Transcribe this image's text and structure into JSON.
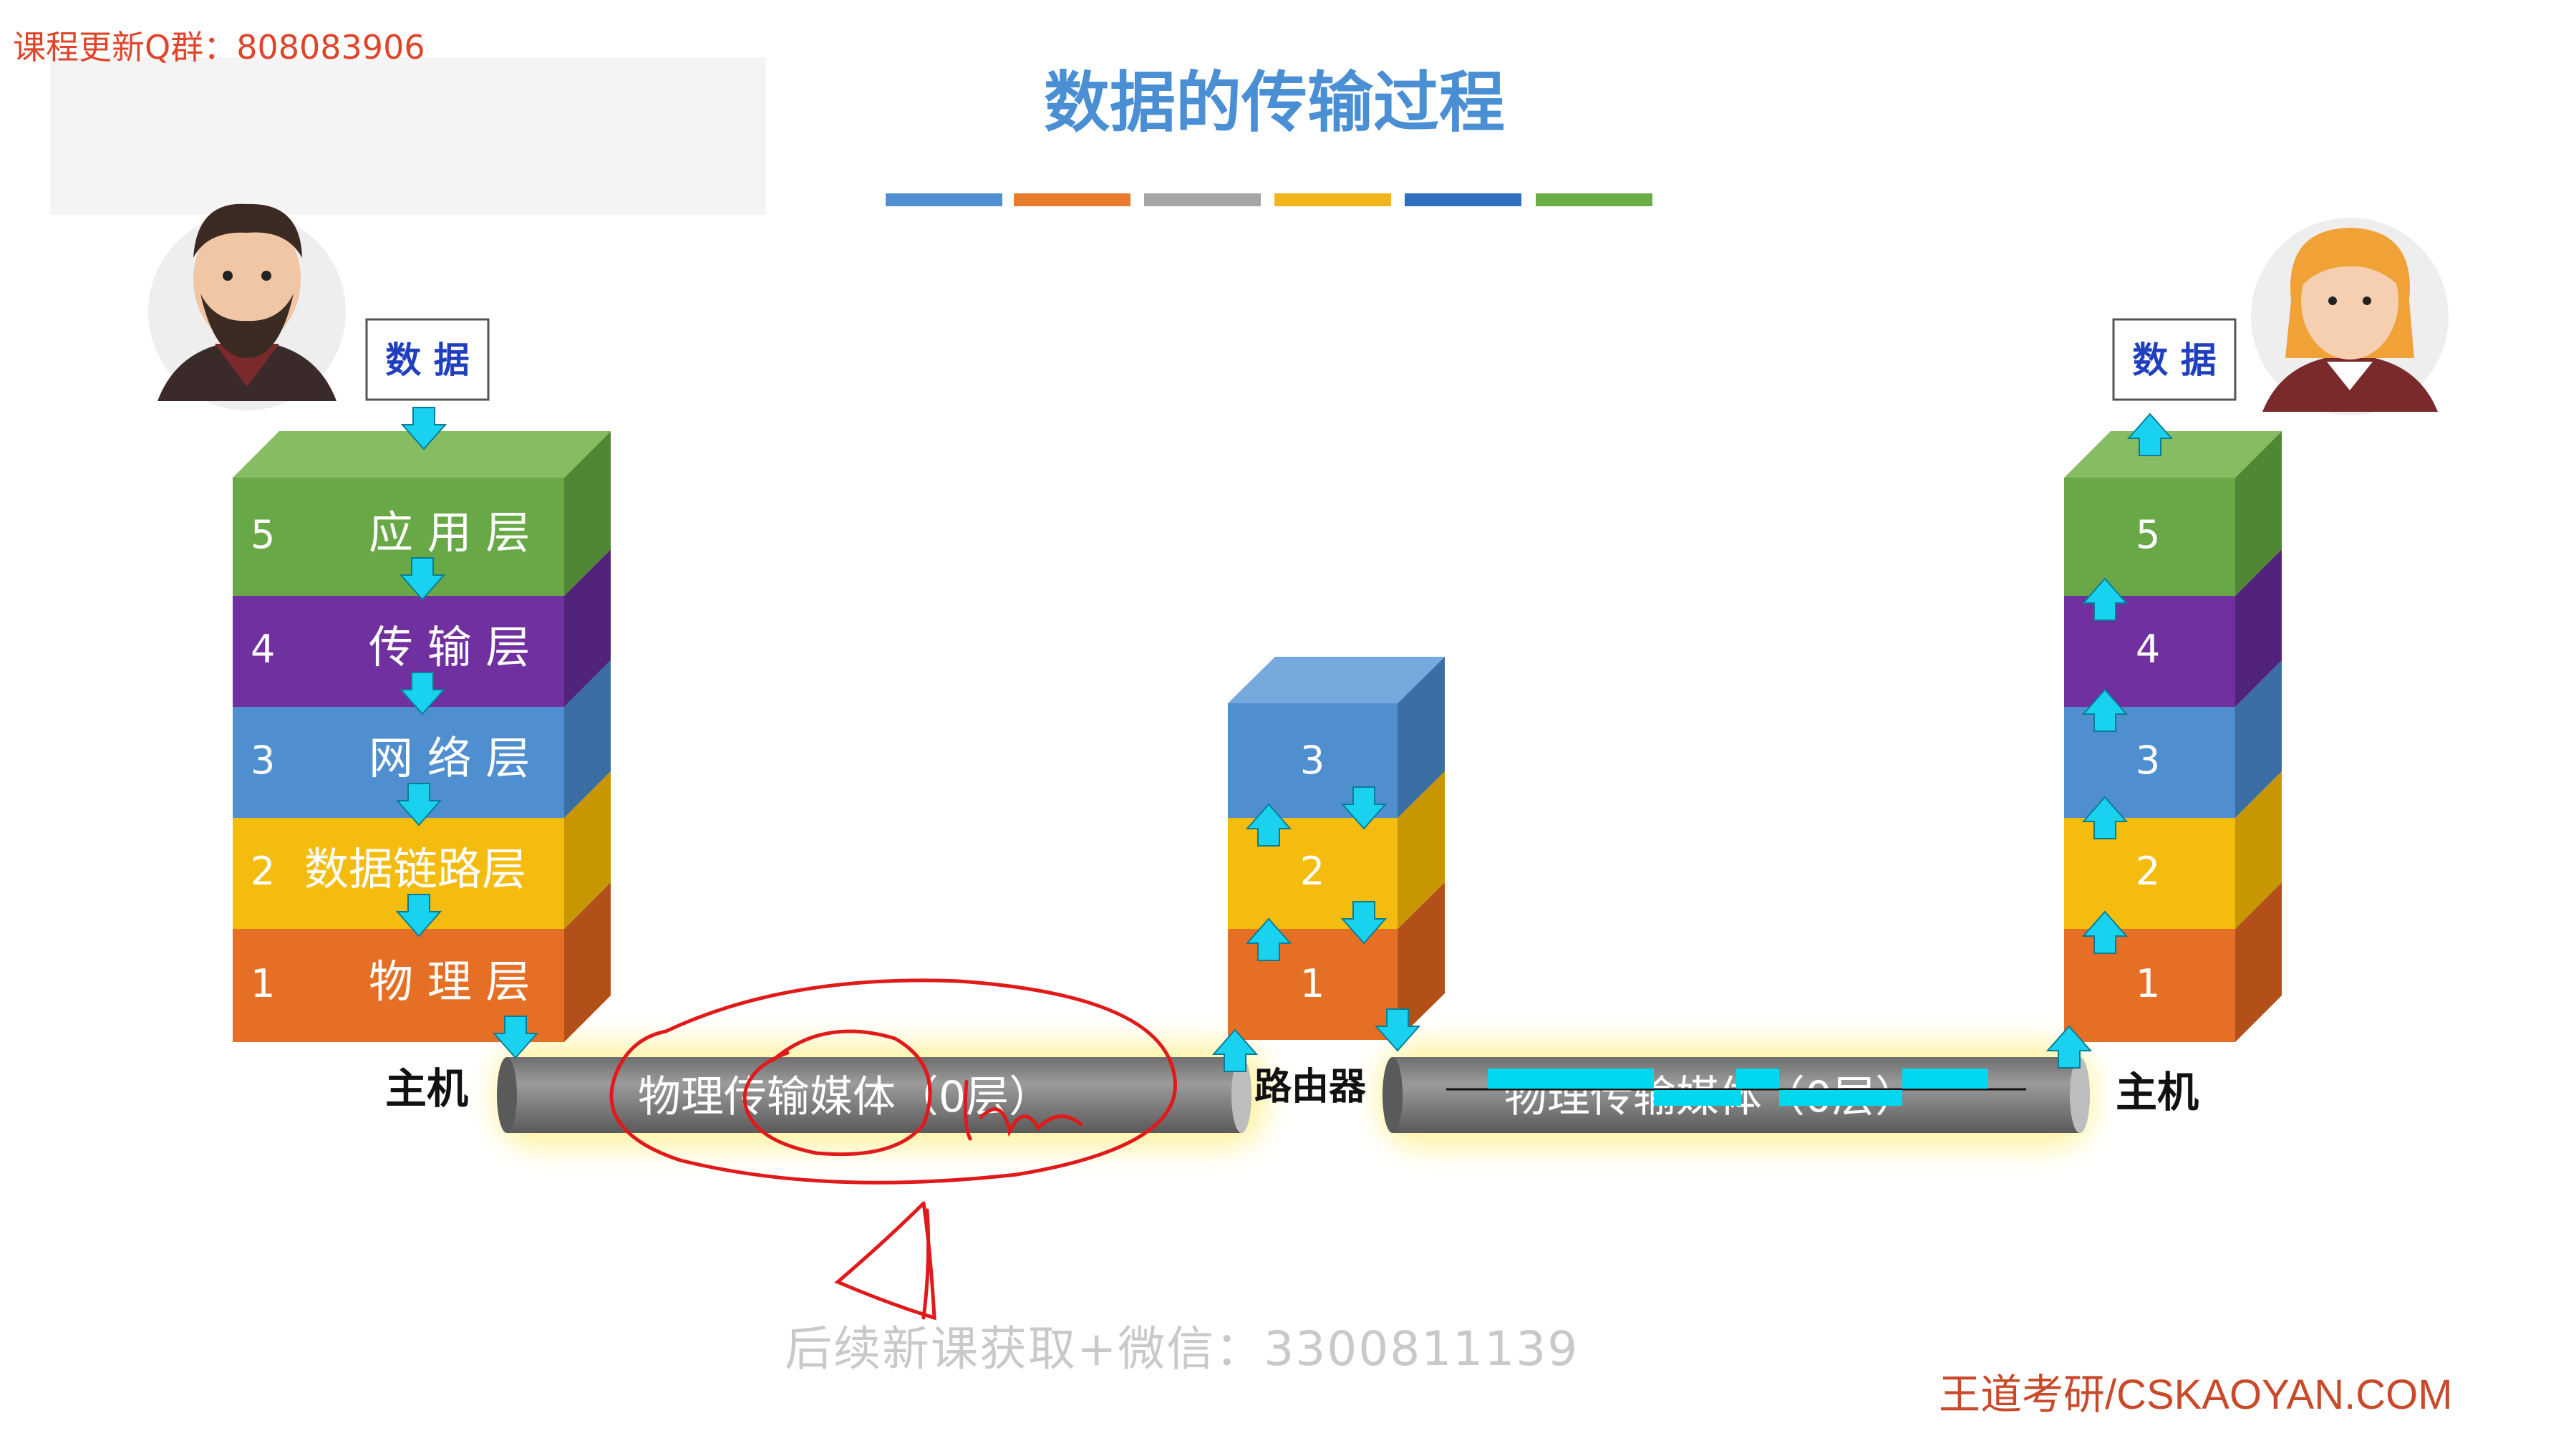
{
  "top_note": "课程更新Q群：808083906",
  "title": "数据的传输过程",
  "title_color": "#4a8fd4",
  "color_bar": [
    "#4f8fd0",
    "#e97b2c",
    "#a5a5a5",
    "#f2b51c",
    "#2f6fbf",
    "#6aac45"
  ],
  "layer_colors": {
    "l5": "#69a847",
    "l4": "#7030a0",
    "l3": "#4f8fd0",
    "l2": "#f5bc10",
    "l1": "#e66f26"
  },
  "data_label_left": "数 据",
  "data_label_right": "数 据",
  "left_host": {
    "label": "主机",
    "layers": [
      {
        "num": "5",
        "name": "应 用 层"
      },
      {
        "num": "4",
        "name": "传 输 层"
      },
      {
        "num": "3",
        "name": "网 络 层"
      },
      {
        "num": "2",
        "name": "数据链路层"
      },
      {
        "num": "1",
        "name": "物 理 层"
      }
    ]
  },
  "router": {
    "label": "路由器",
    "layers": [
      {
        "num": "3"
      },
      {
        "num": "2"
      },
      {
        "num": "1"
      }
    ]
  },
  "right_host": {
    "label": "主机",
    "layers": [
      {
        "num": "5"
      },
      {
        "num": "4"
      },
      {
        "num": "3"
      },
      {
        "num": "2"
      },
      {
        "num": "1"
      }
    ]
  },
  "medium_left": "物理传输媒体（0层）",
  "medium_right": "物理传输媒体（0层）",
  "watermark": "后续新课获取+微信：3300811139",
  "site": "王道考研/CSKAOYAN.COM",
  "icons": [
    "man-avatar-icon",
    "woman-avatar-icon",
    "arrow-down-icon",
    "arrow-up-icon"
  ]
}
